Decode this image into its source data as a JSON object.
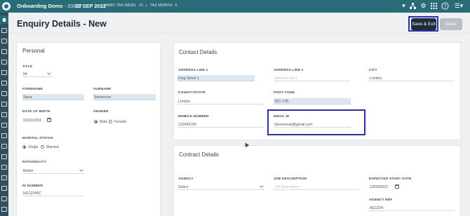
{
  "topbar": {
    "org_name": "Onboarding Demo",
    "org_code": "- 20027",
    "date": "02 SEP 2022",
    "tax_week_label": "HMRC TAX WEEK",
    "tax_week_value": "22",
    "tax_month_label": "TAX MONTH",
    "tax_month_value": "6",
    "icons": [
      "chevron-down-icon",
      "org-chart-icon",
      "gear-icon",
      "apps-grid-icon",
      "help-icon",
      "menu-icon"
    ]
  },
  "page": {
    "title": "Enquiry Details - New",
    "save_exit_label": "Save & Exit",
    "close_label": "Close"
  },
  "personal": {
    "title": "Personal",
    "title_label": "TITLE",
    "title_value": "Mr",
    "forename_label": "FORENAME",
    "forename_value": "Steve",
    "surname_label": "SURNAME",
    "surname_value": "Stevenson",
    "dob_label": "DATE OF BIRTH",
    "dob_value": "01/01/1991",
    "gender_label": "GENDER",
    "gender_male": "Male",
    "gender_female": "Female",
    "marital_label": "MARITAL STATUS",
    "marital_single": "Single",
    "marital_married": "Married",
    "nationality_label": "NATIONALITY",
    "nationality_value": "British",
    "ni_label": "NI NUMBER",
    "ni_value": "NG12345C"
  },
  "contact": {
    "title": "Contact Details",
    "addr1_label": "ADDRESS LINE 1",
    "addr1_value": "King Street 1",
    "addr2_label": "ADDRESS LINE 2",
    "addr2_placeholder": "Address Line2",
    "city_label": "CITY",
    "city_value": "London",
    "county_label": "COUNTY/STATE",
    "county_value": "London",
    "postcode_label": "POST CODE",
    "postcode_value": "TB1 1TB",
    "mobile_label": "MOBILE NUMBER",
    "mobile_value": "123456789",
    "email_label": "EMAIL ID",
    "email_value": "Steveemail@gmail.com"
  },
  "contract": {
    "title": "Contract Details",
    "agency_label": "AGENCY",
    "agency_value": "Select",
    "job_label": "JOB DESCRIPTION",
    "job_placeholder": "Job Description",
    "start_label": "EXPECTED START DATE",
    "start_value": "13/09/2022",
    "agency_ref_label": "AGENCY REF",
    "agency_ref_value": "AG1234"
  },
  "colors": {
    "topbar": "#2a6b78",
    "rail": "#31505b",
    "save_button": "#1d2c36",
    "close_button": "#b9bfc3",
    "highlight_box": "#2d2fa8",
    "filled_field": "#dce8f1"
  }
}
